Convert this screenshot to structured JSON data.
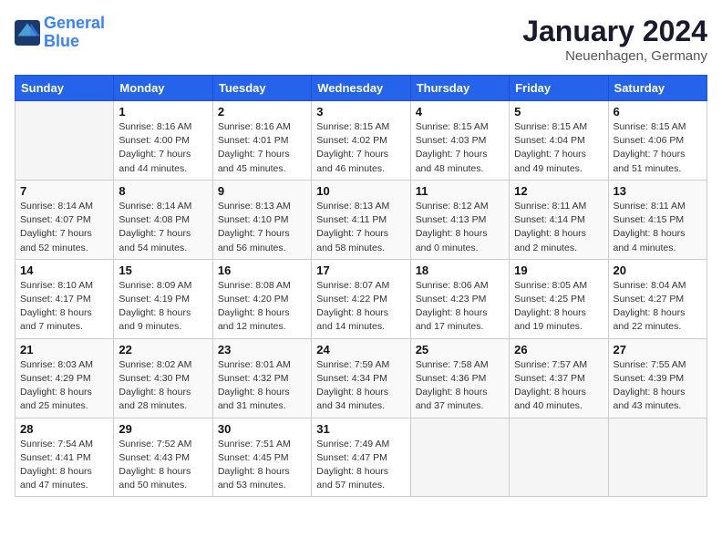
{
  "logo": {
    "line1": "General",
    "line2": "Blue"
  },
  "title": "January 2024",
  "subtitle": "Neuenhagen, Germany",
  "days_header": [
    "Sunday",
    "Monday",
    "Tuesday",
    "Wednesday",
    "Thursday",
    "Friday",
    "Saturday"
  ],
  "weeks": [
    [
      {
        "day": "",
        "sunrise": "",
        "sunset": "",
        "daylight": ""
      },
      {
        "day": "1",
        "sunrise": "Sunrise: 8:16 AM",
        "sunset": "Sunset: 4:00 PM",
        "daylight": "Daylight: 7 hours and 44 minutes."
      },
      {
        "day": "2",
        "sunrise": "Sunrise: 8:16 AM",
        "sunset": "Sunset: 4:01 PM",
        "daylight": "Daylight: 7 hours and 45 minutes."
      },
      {
        "day": "3",
        "sunrise": "Sunrise: 8:15 AM",
        "sunset": "Sunset: 4:02 PM",
        "daylight": "Daylight: 7 hours and 46 minutes."
      },
      {
        "day": "4",
        "sunrise": "Sunrise: 8:15 AM",
        "sunset": "Sunset: 4:03 PM",
        "daylight": "Daylight: 7 hours and 48 minutes."
      },
      {
        "day": "5",
        "sunrise": "Sunrise: 8:15 AM",
        "sunset": "Sunset: 4:04 PM",
        "daylight": "Daylight: 7 hours and 49 minutes."
      },
      {
        "day": "6",
        "sunrise": "Sunrise: 8:15 AM",
        "sunset": "Sunset: 4:06 PM",
        "daylight": "Daylight: 7 hours and 51 minutes."
      }
    ],
    [
      {
        "day": "7",
        "sunrise": "Sunrise: 8:14 AM",
        "sunset": "Sunset: 4:07 PM",
        "daylight": "Daylight: 7 hours and 52 minutes."
      },
      {
        "day": "8",
        "sunrise": "Sunrise: 8:14 AM",
        "sunset": "Sunset: 4:08 PM",
        "daylight": "Daylight: 7 hours and 54 minutes."
      },
      {
        "day": "9",
        "sunrise": "Sunrise: 8:13 AM",
        "sunset": "Sunset: 4:10 PM",
        "daylight": "Daylight: 7 hours and 56 minutes."
      },
      {
        "day": "10",
        "sunrise": "Sunrise: 8:13 AM",
        "sunset": "Sunset: 4:11 PM",
        "daylight": "Daylight: 7 hours and 58 minutes."
      },
      {
        "day": "11",
        "sunrise": "Sunrise: 8:12 AM",
        "sunset": "Sunset: 4:13 PM",
        "daylight": "Daylight: 8 hours and 0 minutes."
      },
      {
        "day": "12",
        "sunrise": "Sunrise: 8:11 AM",
        "sunset": "Sunset: 4:14 PM",
        "daylight": "Daylight: 8 hours and 2 minutes."
      },
      {
        "day": "13",
        "sunrise": "Sunrise: 8:11 AM",
        "sunset": "Sunset: 4:15 PM",
        "daylight": "Daylight: 8 hours and 4 minutes."
      }
    ],
    [
      {
        "day": "14",
        "sunrise": "Sunrise: 8:10 AM",
        "sunset": "Sunset: 4:17 PM",
        "daylight": "Daylight: 8 hours and 7 minutes."
      },
      {
        "day": "15",
        "sunrise": "Sunrise: 8:09 AM",
        "sunset": "Sunset: 4:19 PM",
        "daylight": "Daylight: 8 hours and 9 minutes."
      },
      {
        "day": "16",
        "sunrise": "Sunrise: 8:08 AM",
        "sunset": "Sunset: 4:20 PM",
        "daylight": "Daylight: 8 hours and 12 minutes."
      },
      {
        "day": "17",
        "sunrise": "Sunrise: 8:07 AM",
        "sunset": "Sunset: 4:22 PM",
        "daylight": "Daylight: 8 hours and 14 minutes."
      },
      {
        "day": "18",
        "sunrise": "Sunrise: 8:06 AM",
        "sunset": "Sunset: 4:23 PM",
        "daylight": "Daylight: 8 hours and 17 minutes."
      },
      {
        "day": "19",
        "sunrise": "Sunrise: 8:05 AM",
        "sunset": "Sunset: 4:25 PM",
        "daylight": "Daylight: 8 hours and 19 minutes."
      },
      {
        "day": "20",
        "sunrise": "Sunrise: 8:04 AM",
        "sunset": "Sunset: 4:27 PM",
        "daylight": "Daylight: 8 hours and 22 minutes."
      }
    ],
    [
      {
        "day": "21",
        "sunrise": "Sunrise: 8:03 AM",
        "sunset": "Sunset: 4:29 PM",
        "daylight": "Daylight: 8 hours and 25 minutes."
      },
      {
        "day": "22",
        "sunrise": "Sunrise: 8:02 AM",
        "sunset": "Sunset: 4:30 PM",
        "daylight": "Daylight: 8 hours and 28 minutes."
      },
      {
        "day": "23",
        "sunrise": "Sunrise: 8:01 AM",
        "sunset": "Sunset: 4:32 PM",
        "daylight": "Daylight: 8 hours and 31 minutes."
      },
      {
        "day": "24",
        "sunrise": "Sunrise: 7:59 AM",
        "sunset": "Sunset: 4:34 PM",
        "daylight": "Daylight: 8 hours and 34 minutes."
      },
      {
        "day": "25",
        "sunrise": "Sunrise: 7:58 AM",
        "sunset": "Sunset: 4:36 PM",
        "daylight": "Daylight: 8 hours and 37 minutes."
      },
      {
        "day": "26",
        "sunrise": "Sunrise: 7:57 AM",
        "sunset": "Sunset: 4:37 PM",
        "daylight": "Daylight: 8 hours and 40 minutes."
      },
      {
        "day": "27",
        "sunrise": "Sunrise: 7:55 AM",
        "sunset": "Sunset: 4:39 PM",
        "daylight": "Daylight: 8 hours and 43 minutes."
      }
    ],
    [
      {
        "day": "28",
        "sunrise": "Sunrise: 7:54 AM",
        "sunset": "Sunset: 4:41 PM",
        "daylight": "Daylight: 8 hours and 47 minutes."
      },
      {
        "day": "29",
        "sunrise": "Sunrise: 7:52 AM",
        "sunset": "Sunset: 4:43 PM",
        "daylight": "Daylight: 8 hours and 50 minutes."
      },
      {
        "day": "30",
        "sunrise": "Sunrise: 7:51 AM",
        "sunset": "Sunset: 4:45 PM",
        "daylight": "Daylight: 8 hours and 53 minutes."
      },
      {
        "day": "31",
        "sunrise": "Sunrise: 7:49 AM",
        "sunset": "Sunset: 4:47 PM",
        "daylight": "Daylight: 8 hours and 57 minutes."
      },
      {
        "day": "",
        "sunrise": "",
        "sunset": "",
        "daylight": ""
      },
      {
        "day": "",
        "sunrise": "",
        "sunset": "",
        "daylight": ""
      },
      {
        "day": "",
        "sunrise": "",
        "sunset": "",
        "daylight": ""
      }
    ]
  ]
}
